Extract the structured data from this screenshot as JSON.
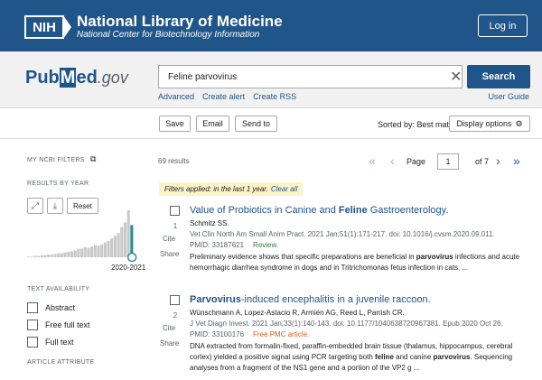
{
  "header": {
    "nih_badge": "NIH",
    "title": "National Library of Medicine",
    "subtitle": "National Center for Biotechnology Information",
    "login_label": "Log in"
  },
  "search": {
    "logo_pub": "Pub",
    "logo_m": "M",
    "logo_ed": "ed",
    "logo_gov": ".gov",
    "query": "Feline parvovirus",
    "clear_icon": "close-icon",
    "search_label": "Search",
    "links": [
      "Advanced",
      "Create alert",
      "Create RSS"
    ],
    "user_guide": "User Guide"
  },
  "actions": {
    "save": "Save",
    "email": "Email",
    "send_to": "Send to",
    "sorted_by": "Sorted by: Best match",
    "display_options": "Display options"
  },
  "sidebar": {
    "my_filters": "MY NCBI FILTERS",
    "results_by_year": "RESULTS BY YEAR",
    "reset": "Reset",
    "year_range": "2020-2021",
    "histogram_values": [
      1,
      1,
      2,
      2,
      3,
      3,
      4,
      4,
      5,
      6,
      6,
      7,
      8,
      9,
      10,
      12,
      13,
      15,
      14,
      16,
      18,
      17,
      19,
      22,
      24,
      28,
      32,
      36,
      45,
      52,
      70,
      48
    ],
    "text_availability": "TEXT AVAILABILITY",
    "checkboxes": [
      "Abstract",
      "Free full text",
      "Full text"
    ],
    "article_attribute": "ARTICLE ATTRIBUTE"
  },
  "results": {
    "count": "69 results",
    "page_label": "Page",
    "page_value": "1",
    "of_pages": "of 7",
    "filters_applied": "Filters applied: in the last 1 year.",
    "clear_all": "Clear all",
    "cite_label": "Cite",
    "share_label": "Share",
    "articles": [
      {
        "num": "1",
        "title_pre": "Value of Probiotics in Canine and ",
        "title_bold": "Feline",
        "title_post": " Gastroenterology.",
        "authors": "Schmitz SS.",
        "journal": "Vet Clin North Am Small Anim Pract. 2021 Jan;51(1):171-217. doi: 10.1016/j.cvsm.2020.09.011.",
        "pmid": "PMID: 33187621",
        "tag": "Review.",
        "snippet_a": "Preliminary evidence shows that specific preparations are beneficial in ",
        "snippet_b": "parvovirus",
        "snippet_c": " infections and acute hemorrhagic diarrhea syndrome in dogs and in Tritrichomonas fetus infection in cats. ..."
      },
      {
        "num": "2",
        "title_bold": "Parvovirus",
        "title_post": "-induced encephalitis in a juvenile raccoon.",
        "authors": "Wünschmann A, Lopez-Astacio R, Armién AG, Reed L, Parrish CR.",
        "journal": "J Vet Diagn Invest. 2021 Jan;33(1):140-143. doi: 10.1177/1040638720967381. Epub 2020 Oct 26.",
        "pmid": "PMID: 33100176",
        "tag": "Free PMC article.",
        "snippet_a": "DNA extracted from formalin-fixed, paraffin-embedded brain tissue (thalamus, hippocampus, cerebral cortex) yielded a positive signal using PCR targeting both ",
        "snippet_b": "feline",
        "snippet_c": " and canine ",
        "snippet_d": "parvovirus",
        "snippet_e": ". Sequencing analyses from a fragment of the NS1 gene and a portion of the VP2 g ..."
      }
    ]
  },
  "colors": {
    "brand": "#20558a",
    "background_band": "#f1f1f1",
    "filter_note": "#fdf3c8",
    "histogram_bar": "#c9c9c9",
    "histogram_highlight": "#2a8e8e"
  }
}
